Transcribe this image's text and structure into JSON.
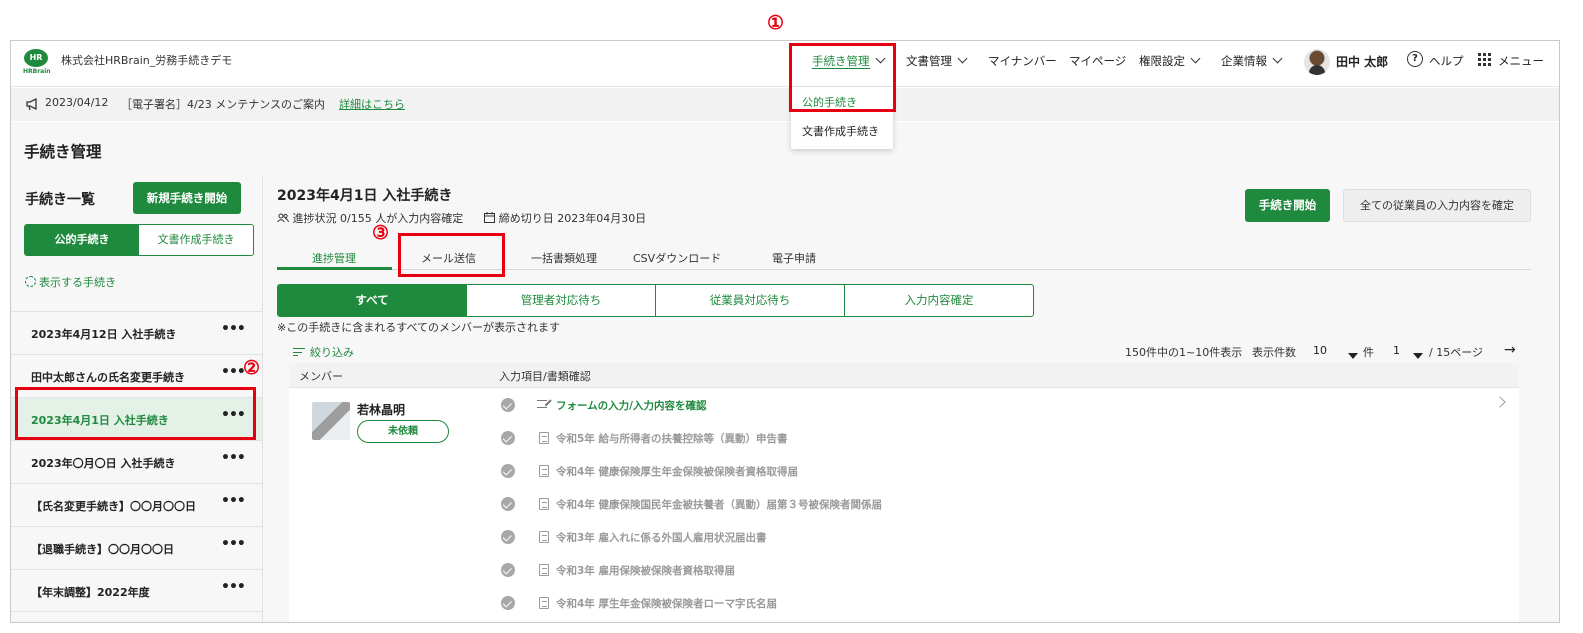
{
  "header": {
    "logo_text": "HR",
    "logo_sub": "HRBrain",
    "company": "株式会社HRBrain_労務手続きデモ",
    "nav": {
      "procedures": "手続き管理",
      "documents": "文書管理",
      "mynumber": "マイナンバー",
      "mypage": "マイページ",
      "permissions": "権限設定",
      "company_info": "企業情報",
      "user_name": "田中 太郎",
      "help": "ヘルプ",
      "menu": "メニュー"
    },
    "help_glyph": "?"
  },
  "dropdown": {
    "items": [
      "公的手続き",
      "文書作成手続き"
    ]
  },
  "announcement": {
    "date": "2023/04/12",
    "text": "［電子署名］4/23 メンテナンスのご案内",
    "link": "詳細はこちら"
  },
  "page_title": "手続き管理",
  "sidebar": {
    "title": "手続き一覧",
    "new_button": "新規手続き開始",
    "segment": [
      "公的手続き",
      "文書作成手続き"
    ],
    "show_link": "表示する手続き",
    "more_glyph": "•••",
    "items": [
      "2023年4月12日 入社手続き",
      "田中太郎さんの氏名変更手続き",
      "2023年4月1日 入社手続き",
      "2023年〇月〇日 入社手続き",
      "【氏名変更手続き】〇〇月〇〇日",
      "【退職手続き】〇〇月〇〇日",
      "【年末調整】2022年度"
    ],
    "selected_index": 2
  },
  "main": {
    "title": "2023年4月1日 入社手続き",
    "progress": "進捗状況 0/155 人が入力内容確定",
    "deadline": "締め切り日 2023年04月30日",
    "start_button": "手続き開始",
    "confirm_all_button": "全ての従業員の入力内容を確定",
    "tabs": [
      "進捗管理",
      "メール送信",
      "一括書類処理",
      "CSVダウンロード",
      "電子申請"
    ],
    "filters": [
      "すべて",
      "管理者対応待ち",
      "従業員対応待ち",
      "入力内容確定"
    ],
    "note": "※この手続きに含まれるすべてのメンバーが表示されます",
    "filter_link": "絞り込み",
    "pager": {
      "summary": "150件中の1~10件表示",
      "per_page_label": "表示件数",
      "per_page": "10",
      "unit": "件",
      "page": "1",
      "total_pages": "/ 15ページ",
      "next": "→"
    },
    "table": {
      "headers": [
        "メンバー",
        "入力項目/書類確認"
      ],
      "member": {
        "name": "若林晶明",
        "status": "未依頼"
      },
      "items": [
        "フォームの入力/入力内容を確認",
        "令和5年 給与所得者の扶養控除等（異動）申告書",
        "令和4年 健康保険厚生年金保険被保険者資格取得届",
        "令和4年 健康保険国民年金被扶養者（異動）届第３号被保険者関係届",
        "令和3年 雇入れに係る外国人雇用状況届出書",
        "令和3年 雇用保険被保険者資格取得届",
        "令和4年 厚生年金保険被保険者ローマ字氏名届"
      ]
    }
  },
  "annotations": [
    "①",
    "②",
    "③"
  ],
  "colors": {
    "brand": "#1f8a3e",
    "highlight": "#e60012",
    "selected_bg": "#e4f1e7"
  }
}
